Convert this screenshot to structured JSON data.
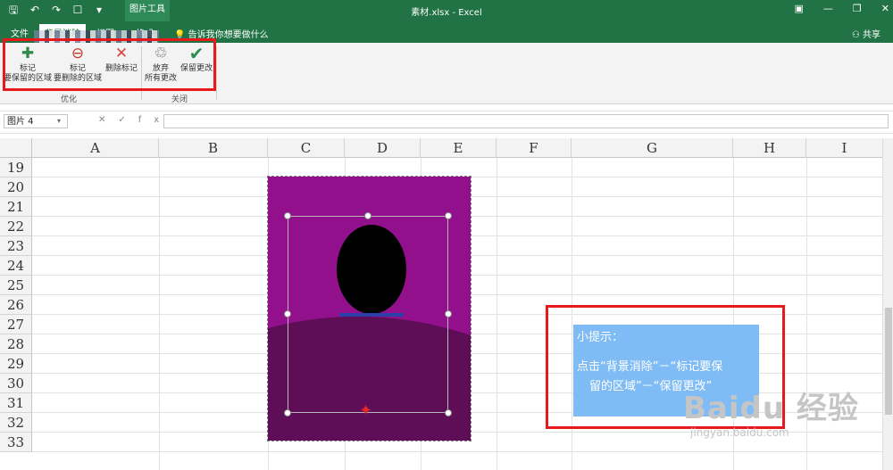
{
  "titlebar": {
    "doc_title": "素材.xlsx  -  Excel",
    "context_tab": "图片工具",
    "qat_icons": [
      "save-icon",
      "undo-icon",
      "redo-icon",
      "touch-icon",
      "customize-icon"
    ]
  },
  "tabs": {
    "file": "文件",
    "active": "背景消除",
    "view": "视图",
    "format": "格式",
    "tell_me": "告诉我你想要做什么",
    "share": "共享"
  },
  "ribbon": {
    "mark_keep_line1": "标记",
    "mark_keep_line2": "要保留的区域",
    "mark_remove_line1": "标记",
    "mark_remove_line2": "要删除的区域",
    "delete_mark": "删除标记",
    "discard_line1": "放弃",
    "discard_line2": "所有更改",
    "keep_changes": "保留更改",
    "group_refine": "优化",
    "group_close": "关闭"
  },
  "formula_bar": {
    "name_box": "图片 4",
    "fx": "fx",
    "formula": ""
  },
  "grid": {
    "columns": [
      "A",
      "B",
      "C",
      "D",
      "E",
      "F",
      "G",
      "H",
      "I"
    ],
    "rows": [
      "19",
      "20",
      "21",
      "22",
      "23",
      "24",
      "25",
      "26",
      "27",
      "28",
      "29",
      "30",
      "31",
      "32",
      "33"
    ]
  },
  "note": {
    "title": "小提示：",
    "line1": "点击“背景消除”－“标记要保",
    "line2": "留的区域”－“保留更改”"
  },
  "watermark": {
    "logo": "Baidu 经验",
    "url": "jingyan.baidu.com"
  },
  "colors": {
    "excel_green": "#217346",
    "highlight_red": "#e8191b",
    "purple_bg": "#92108b",
    "dark_purple": "#5e0d57",
    "note_blue": "#7fbcf5"
  }
}
